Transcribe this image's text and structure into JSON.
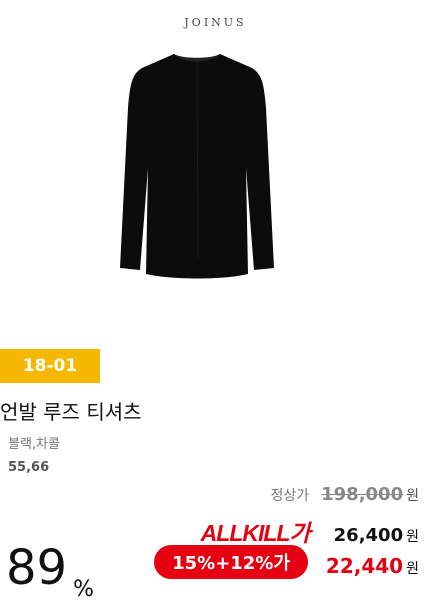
{
  "product": {
    "brand": "JOINUS",
    "code": "18-01",
    "name": "언발 루즈 티셔츠",
    "colors": "블랙,차콜",
    "sizes": "55,66"
  },
  "pricing": {
    "regular_label": "정상가",
    "regular_price": "198,000",
    "currency": "원",
    "allkill_label": "ALLKILL가",
    "allkill_price": "26,400",
    "coupon_label": "15%+12%가",
    "sale_price": "22,440",
    "discount_value": "89",
    "discount_unit": "%"
  },
  "colors": {
    "badge": "#f5b800",
    "accent_red": "#e60012"
  },
  "icons": {
    "product_image": "black-longsleeve-tshirt"
  }
}
